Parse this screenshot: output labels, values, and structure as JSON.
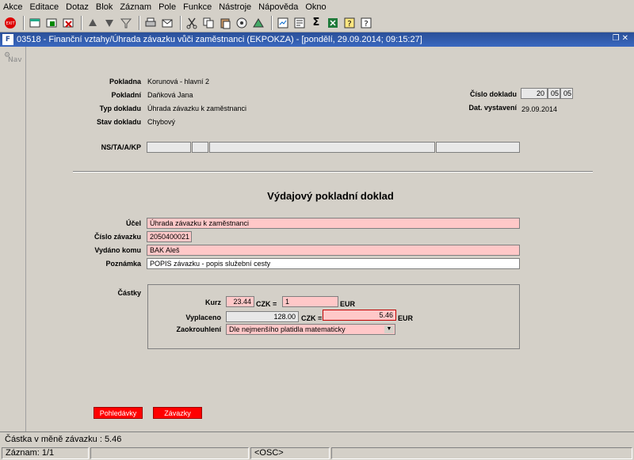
{
  "menu": [
    "Akce",
    "Editace",
    "Dotaz",
    "Blok",
    "Záznam",
    "Pole",
    "Funkce",
    "Nástroje",
    "Nápověda",
    "Okno"
  ],
  "toolbar_icons": [
    "exit-icon",
    "new-record-icon",
    "save-icon",
    "delete-icon",
    "up-icon",
    "down-icon",
    "filter-icon",
    "print-icon",
    "mail-icon",
    "cut-icon",
    "copy-icon",
    "paste-icon",
    "calc-icon",
    "chart-icon",
    "report-icon",
    "query-icon",
    "sum-icon",
    "excel-icon",
    "help-icon",
    "context-help-icon"
  ],
  "window": {
    "title": "03518 - Finanční vztahy/Úhrada závazku vůči zaměstnanci (EKPOKZA) - [pondělí, 29.09.2014; 09:15:27]",
    "icon_text": "F"
  },
  "nav": {
    "label": "Nav"
  },
  "header": {
    "pokladna_label": "Pokladna",
    "pokladna_value": "Korunová - hlavní 2",
    "pokladni_label": "Pokladní",
    "pokladni_value": "Daňková Jana",
    "typ_label": "Typ dokladu",
    "typ_value": "Úhrada závazku k zaměstnanci",
    "stav_label": "Stav dokladu",
    "stav_value": "Chybový",
    "cislo_label": "Číslo dokladu",
    "cislo_parts": [
      "20",
      "05",
      "05"
    ],
    "dat_label": "Dat. vystavení",
    "dat_value": "29.09.2014",
    "ns_label": "NS/TA/A/KP"
  },
  "form": {
    "heading": "Výdajový pokladní doklad",
    "ucel_label": "Účel",
    "ucel_value": "Úhrada závazku k zaměstnanci",
    "cislo_zav_label": "Číslo závazku",
    "cislo_zav_value": "2050400021",
    "vydano_label": "Vydáno komu",
    "vydano_value": "BAK Aleš",
    "poznamka_label": "Poznámka",
    "poznamka_value": "POPIS závazku - popis služební cesty"
  },
  "castky": {
    "label": "Částky",
    "kurz_label": "Kurz",
    "kurz_value": "23.44",
    "czk_eq": "CZK =",
    "kurz_eur_value": "1",
    "eur": "EUR",
    "vyplaceno_label": "Vyplaceno",
    "vyplaceno_czk": "128.00",
    "czk_eq2": "CZK =",
    "vyplaceno_eur": "5.46",
    "zaokrouhleni_label": "Zaokrouhlení",
    "zaokrouhleni_value": "Dle nejmenšího platidla matematicky"
  },
  "buttons": {
    "pohledavky": "Pohledávky",
    "zavazky": "Závazky"
  },
  "status": {
    "message": "Částka v měně závazku : 5.46",
    "record": "Záznam: 1/1",
    "osc": "<OSC>"
  }
}
